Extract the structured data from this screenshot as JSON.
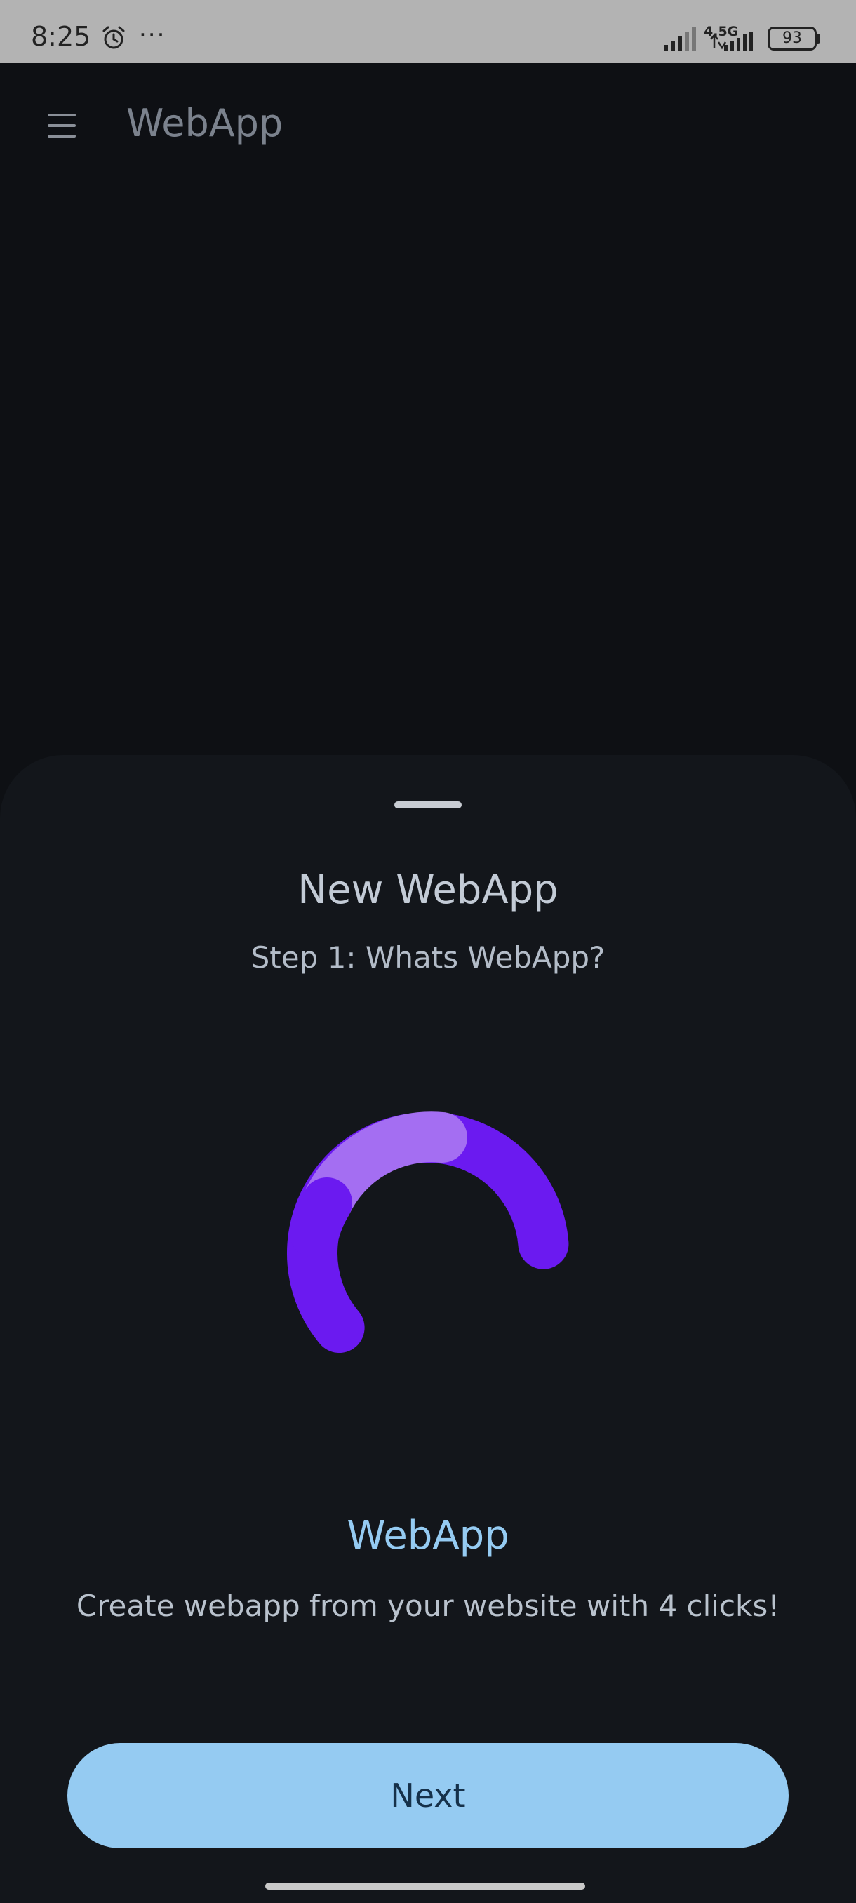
{
  "status_bar": {
    "time": "8:25",
    "network": "4.5G",
    "battery": "93",
    "icons": [
      "alarm-icon",
      "more-dots-icon",
      "signal-icon",
      "battery-icon"
    ]
  },
  "app_bar": {
    "title": "WebApp",
    "menu_icon": "hamburger-icon"
  },
  "sheet": {
    "title": "New WebApp",
    "subtitle": "Step 1: Whats WebApp?",
    "logo_colors": {
      "light": "#a46ef2",
      "dark": "#6b1af0"
    },
    "brand": "WebApp",
    "tagline": "Create webapp from your website with 4 clicks!",
    "next_label": "Next"
  },
  "colors": {
    "accent": "#95cbf2",
    "background": "#0e1014",
    "sheet": "#13161b"
  }
}
